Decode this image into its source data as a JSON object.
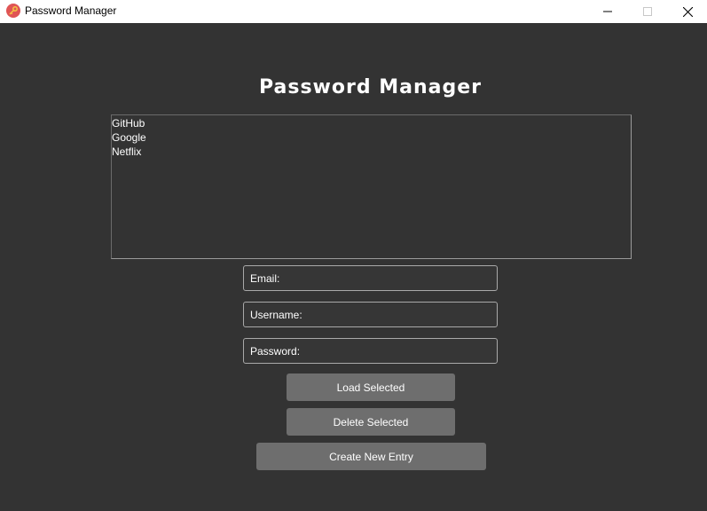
{
  "window": {
    "title": "Password Manager",
    "icon": "key-icon",
    "controls": [
      "minimize-icon",
      "maximize-icon",
      "close-icon"
    ]
  },
  "main": {
    "heading": "Password Manager",
    "entries": [
      "GitHub",
      "Google",
      "Netflix"
    ],
    "fields": {
      "email": {
        "placeholder": "Email:",
        "value": ""
      },
      "username": {
        "placeholder": "Username:",
        "value": ""
      },
      "password": {
        "placeholder": "Password:",
        "value": ""
      }
    },
    "buttons": {
      "load": "Load Selected",
      "delete": "Delete Selected",
      "create": "Create New Entry"
    }
  },
  "colors": {
    "background": "#333333",
    "button": "#6e6e6e",
    "field_border": "#a9a9a9",
    "text": "#ffffff",
    "titlebar": "#ffffff",
    "app_icon": "#e05555"
  }
}
